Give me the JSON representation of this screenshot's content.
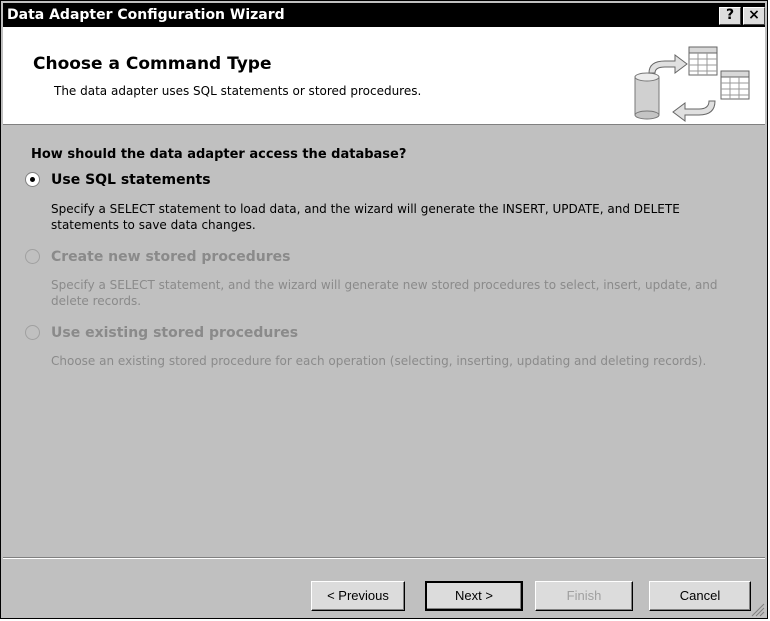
{
  "window": {
    "title": "Data Adapter Configuration Wizard",
    "help_label": "?",
    "close_label": "×"
  },
  "header": {
    "title": "Choose a Command Type",
    "subtitle": "The data adapter uses SQL statements or stored procedures.",
    "icon": "database-transfer-icon"
  },
  "main": {
    "question": "How should the data adapter access the database?",
    "options": [
      {
        "label": "Use SQL statements",
        "description": "Specify a SELECT statement to load data, and the wizard will generate the INSERT, UPDATE, and DELETE statements to save data changes.",
        "selected": true,
        "enabled": true
      },
      {
        "label": "Create new stored procedures",
        "description": "Specify a SELECT statement, and the wizard will generate new stored procedures to select, insert, update, and delete records.",
        "selected": false,
        "enabled": false
      },
      {
        "label": "Use existing stored procedures",
        "description": "Choose an existing stored procedure for each operation (selecting, inserting, updating and deleting records).",
        "selected": false,
        "enabled": false
      }
    ]
  },
  "footer": {
    "previous_label": "< Previous",
    "next_label": "Next >",
    "finish_label": "Finish",
    "cancel_label": "Cancel"
  }
}
